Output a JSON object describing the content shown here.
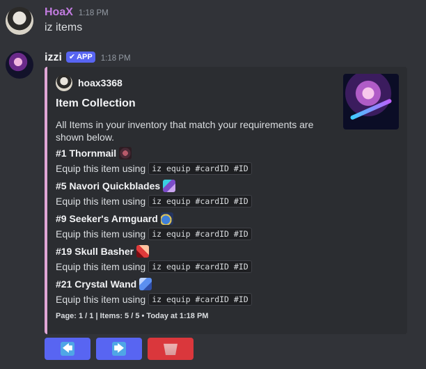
{
  "messages": [
    {
      "username": "HoaX",
      "timestamp": "1:18 PM",
      "text": "iz items"
    },
    {
      "username": "izzi",
      "badge": "APP",
      "badge_check": "✔",
      "timestamp": "1:18 PM"
    }
  ],
  "embed": {
    "accent_color": "#e0a6d6",
    "author": "hoax3368",
    "title": "Item Collection",
    "description": "All Items in your inventory that match your requirements are shown below.",
    "items": [
      {
        "name": "#1 Thornmail",
        "prefix": "Equip this item using",
        "command": "iz equip #cardID #ID"
      },
      {
        "name": "#5 Navori Quickblades",
        "prefix": "Equip this item using",
        "command": "iz equip #cardID #ID"
      },
      {
        "name": "#9 Seeker's Armguard",
        "prefix": "Equip this item using",
        "command": "iz equip #cardID #ID"
      },
      {
        "name": "#19 Skull Basher",
        "prefix": "Equip this item using",
        "command": "iz equip #cardID #ID"
      },
      {
        "name": "#21 Crystal Wand",
        "prefix": "Equip this item using",
        "command": "iz equip #cardID #ID"
      }
    ],
    "footer": "Page: 1 / 1 | Items: 5 / 5 • Today at 1:18 PM"
  },
  "buttons": {
    "prev_glyph": "🡄",
    "next_glyph": "🡆",
    "colors": {
      "primary": "#5865f2",
      "danger": "#da373c"
    }
  }
}
